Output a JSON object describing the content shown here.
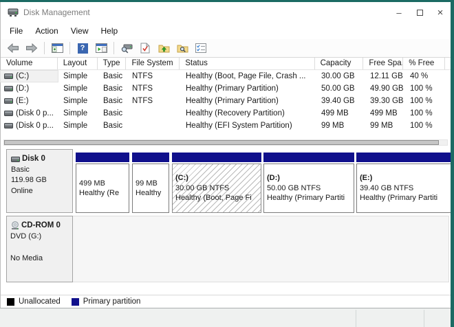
{
  "window": {
    "title": "Disk Management",
    "controls": {
      "minimize": "–",
      "close": "×"
    }
  },
  "menu": {
    "items": [
      "File",
      "Action",
      "View",
      "Help"
    ]
  },
  "toolbar": {
    "help_glyph": "?",
    "icons": [
      "back",
      "forward",
      "console-tree",
      "help",
      "action-pane",
      "rescan-disks",
      "check-document",
      "folder-up",
      "folder-find",
      "properties-list"
    ]
  },
  "volumes_table": {
    "columns": [
      "Volume",
      "Layout",
      "Type",
      "File System",
      "Status",
      "Capacity",
      "Free Spa...",
      "% Free"
    ],
    "rows": [
      {
        "volume": "(C:)",
        "layout": "Simple",
        "type": "Basic",
        "fs": "NTFS",
        "status": "Healthy (Boot, Page File, Crash ...",
        "capacity": "30.00 GB",
        "free": "12.11 GB",
        "pct": "40 %"
      },
      {
        "volume": "(D:)",
        "layout": "Simple",
        "type": "Basic",
        "fs": "NTFS",
        "status": "Healthy (Primary Partition)",
        "capacity": "50.00 GB",
        "free": "49.90 GB",
        "pct": "100 %"
      },
      {
        "volume": "(E:)",
        "layout": "Simple",
        "type": "Basic",
        "fs": "NTFS",
        "status": "Healthy (Primary Partition)",
        "capacity": "39.40 GB",
        "free": "39.30 GB",
        "pct": "100 %"
      },
      {
        "volume": "(Disk 0 p...",
        "layout": "Simple",
        "type": "Basic",
        "fs": "",
        "status": "Healthy (Recovery Partition)",
        "capacity": "499 MB",
        "free": "499 MB",
        "pct": "100 %"
      },
      {
        "volume": "(Disk 0 p...",
        "layout": "Simple",
        "type": "Basic",
        "fs": "",
        "status": "Healthy (EFI System Partition)",
        "capacity": "99 MB",
        "free": "99 MB",
        "pct": "100 %"
      }
    ]
  },
  "disk0": {
    "name": "Disk 0",
    "type": "Basic",
    "size": "119.98 GB",
    "status": "Online",
    "partitions": [
      {
        "title": "",
        "size": "499 MB",
        "status": "Healthy (Re"
      },
      {
        "title": "",
        "size": "99 MB",
        "status": "Healthy"
      },
      {
        "title": "(C:)",
        "size": "30.00 GB NTFS",
        "status": "Healthy (Boot, Page Fi",
        "selected": true
      },
      {
        "title": "(D:)",
        "size": "50.00 GB NTFS",
        "status": "Healthy (Primary Partiti",
        "selected": false
      },
      {
        "title": "(E:)",
        "size": "39.40 GB NTFS",
        "status": "Healthy (Primary Partiti",
        "selected": false
      }
    ]
  },
  "cdrom": {
    "name": "CD-ROM 0",
    "drive": "DVD (G:)",
    "media": "No Media"
  },
  "legend": {
    "items": [
      {
        "label": "Unallocated",
        "color": "#000000"
      },
      {
        "label": "Primary partition",
        "color": "#10108c"
      }
    ]
  },
  "colors": {
    "primary_partition": "#10108c",
    "unallocated": "#000000",
    "desktop_teal": "#1c6a63"
  }
}
